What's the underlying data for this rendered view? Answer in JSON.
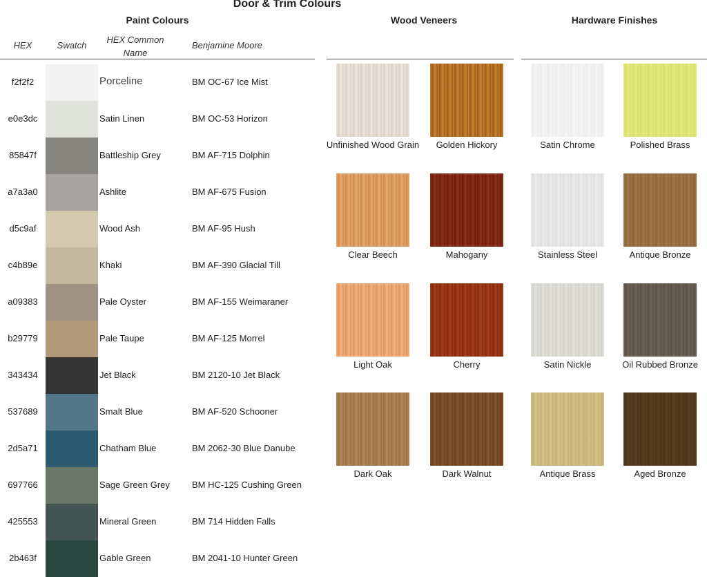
{
  "title": "Door & Trim Colours",
  "paint": {
    "heading": "Paint Colours",
    "col_hex": "HEX",
    "col_swatch": "Swatch",
    "col_name_1": "HEX Common",
    "col_name_2": "Name",
    "col_bm": "Benjamine Moore",
    "rows": [
      {
        "hex": "f2f2f2",
        "color": "#f2f2f2",
        "name": "Porceline",
        "bm": "BM OC-67 Ice Mist"
      },
      {
        "hex": "e0e3dc",
        "color": "#e0e3dc",
        "name": "Satin Linen",
        "bm": "BM OC-53 Horizon"
      },
      {
        "hex": "85847f",
        "color": "#85847f",
        "name": "Battleship Grey",
        "bm": "BM AF-715 Dolphin"
      },
      {
        "hex": "a7a3a0",
        "color": "#a7a3a0",
        "name": "Ashlite",
        "bm": "BM AF-675 Fusion"
      },
      {
        "hex": "d5c9af",
        "color": "#d5c9af",
        "name": "Wood Ash",
        "bm": "BM AF-95 Hush"
      },
      {
        "hex": "c4b89e",
        "color": "#c4b89e",
        "name": "Khaki",
        "bm": "BM AF-390 Glacial Till"
      },
      {
        "hex": "a09383",
        "color": "#a09383",
        "name": "Pale Oyster",
        "bm": "BM AF-155 Weimaraner"
      },
      {
        "hex": "b29779",
        "color": "#b29779",
        "name": "Pale Taupe",
        "bm": "BM AF-125 Morrel"
      },
      {
        "hex": "343434",
        "color": "#343434",
        "name": "Jet Black",
        "bm": "BM 2120-10 Jet Black"
      },
      {
        "hex": "537689",
        "color": "#537689",
        "name": "Smalt Blue",
        "bm": "BM AF-520 Schooner"
      },
      {
        "hex": "2d5a71",
        "color": "#2d5a71",
        "name": "Chatham Blue",
        "bm": "BM 2062-30 Blue Danube"
      },
      {
        "hex": "697766",
        "color": "#697766",
        "name": "Sage Green Grey",
        "bm": "BM HC-125 Cushing Green"
      },
      {
        "hex": "425553",
        "color": "#425553",
        "name": "Mineral Green",
        "bm": "BM 714 Hidden Falls"
      },
      {
        "hex": "2b463f",
        "color": "#2b463f",
        "name": "Gable Green",
        "bm": "BM 2041-10 Hunter Green"
      }
    ]
  },
  "wood": {
    "heading": "Wood Veneers",
    "items": [
      {
        "label": "Unfinished Wood Grain",
        "c1": "#ede7df",
        "c2": "#d9d0c4"
      },
      {
        "label": "Golden Hickory",
        "c1": "#c9852f",
        "c2": "#9e5a1a"
      },
      {
        "label": "Clear Beech",
        "c1": "#e6ab6c",
        "c2": "#cf8b4c"
      },
      {
        "label": "Mahogany",
        "c1": "#8f3317",
        "c2": "#6a1e0c"
      },
      {
        "label": "Light Oak",
        "c1": "#f3b47e",
        "c2": "#e09660"
      },
      {
        "label": "Cherry",
        "c1": "#a8401c",
        "c2": "#852a0f"
      },
      {
        "label": "Dark Oak",
        "c1": "#b08a5c",
        "c2": "#987044"
      },
      {
        "label": "Dark Walnut",
        "c1": "#85552f",
        "c2": "#6b3f20"
      }
    ]
  },
  "hardware": {
    "heading": "Hardware Finishes",
    "items": [
      {
        "label": "Satin Chrome",
        "c1": "#f5f5f5",
        "c2": "#ececec"
      },
      {
        "label": "Polished Brass",
        "c1": "#e4ea80",
        "c2": "#d8e06a"
      },
      {
        "label": "Stainless Steel",
        "c1": "#ececea",
        "c2": "#dedede"
      },
      {
        "label": "Antique Bronze",
        "c1": "#a17848",
        "c2": "#8e6538"
      },
      {
        "label": "Satin Nickle",
        "c1": "#e2e1dc",
        "c2": "#d2d1cb"
      },
      {
        "label": "Oil Rubbed Bronze",
        "c1": "#6d6257",
        "c2": "#5b5147"
      },
      {
        "label": "Antique Brass",
        "c1": "#d4c38a",
        "c2": "#c3b176"
      },
      {
        "label": "Aged Bronze",
        "c1": "#57401f",
        "c2": "#4a3418"
      }
    ]
  }
}
